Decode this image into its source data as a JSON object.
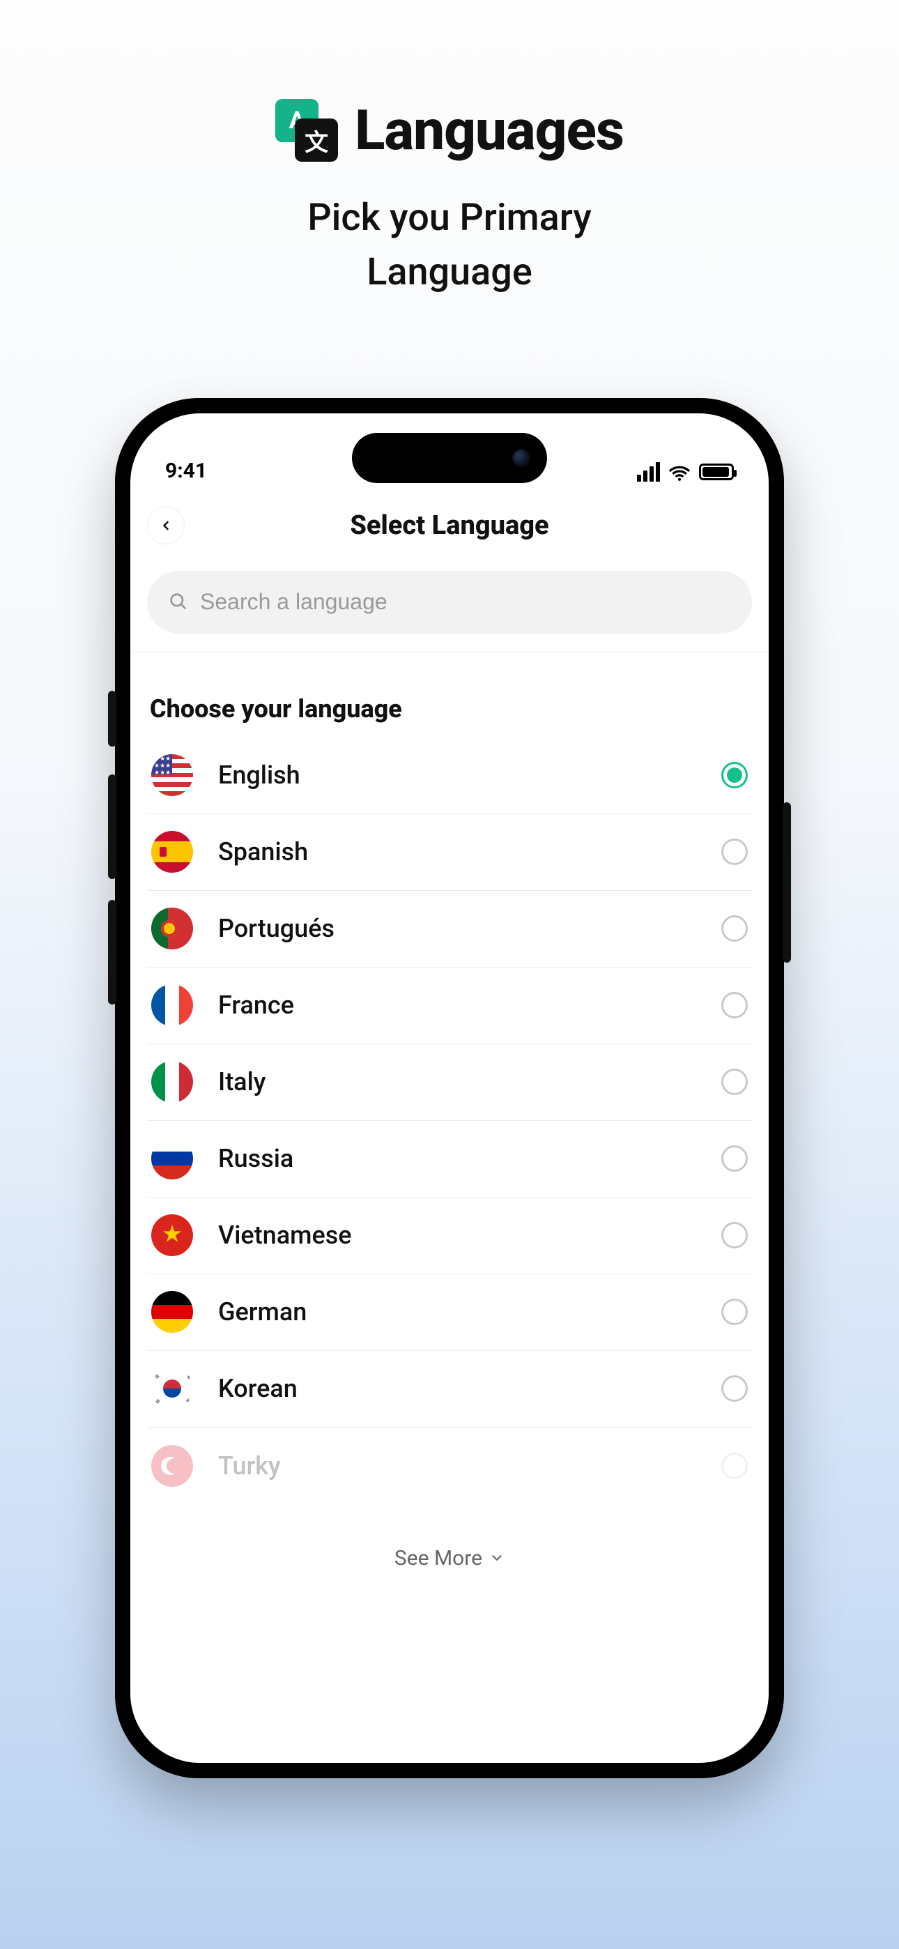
{
  "promo": {
    "title": "Languages",
    "subtitle_line1": "Pick you Primary",
    "subtitle_line2": "Language",
    "icon_back_letter": "A",
    "icon_front_letter": "文"
  },
  "status": {
    "time": "9:41"
  },
  "nav": {
    "title": "Select Language"
  },
  "search": {
    "placeholder": "Search a language"
  },
  "section": {
    "heading": "Choose your language"
  },
  "languages": [
    {
      "name": "English",
      "flag": "us",
      "selected": true,
      "faded": false
    },
    {
      "name": "Spanish",
      "flag": "es",
      "selected": false,
      "faded": false
    },
    {
      "name": "Portugués",
      "flag": "pt",
      "selected": false,
      "faded": false
    },
    {
      "name": "France",
      "flag": "fr",
      "selected": false,
      "faded": false
    },
    {
      "name": "Italy",
      "flag": "it",
      "selected": false,
      "faded": false
    },
    {
      "name": "Russia",
      "flag": "ru",
      "selected": false,
      "faded": false
    },
    {
      "name": "Vietnamese",
      "flag": "vn",
      "selected": false,
      "faded": false
    },
    {
      "name": "German",
      "flag": "de",
      "selected": false,
      "faded": false
    },
    {
      "name": "Korean",
      "flag": "kr",
      "selected": false,
      "faded": false
    },
    {
      "name": "Turky",
      "flag": "tr",
      "selected": false,
      "faded": true
    }
  ],
  "footer": {
    "see_more": "See More"
  }
}
